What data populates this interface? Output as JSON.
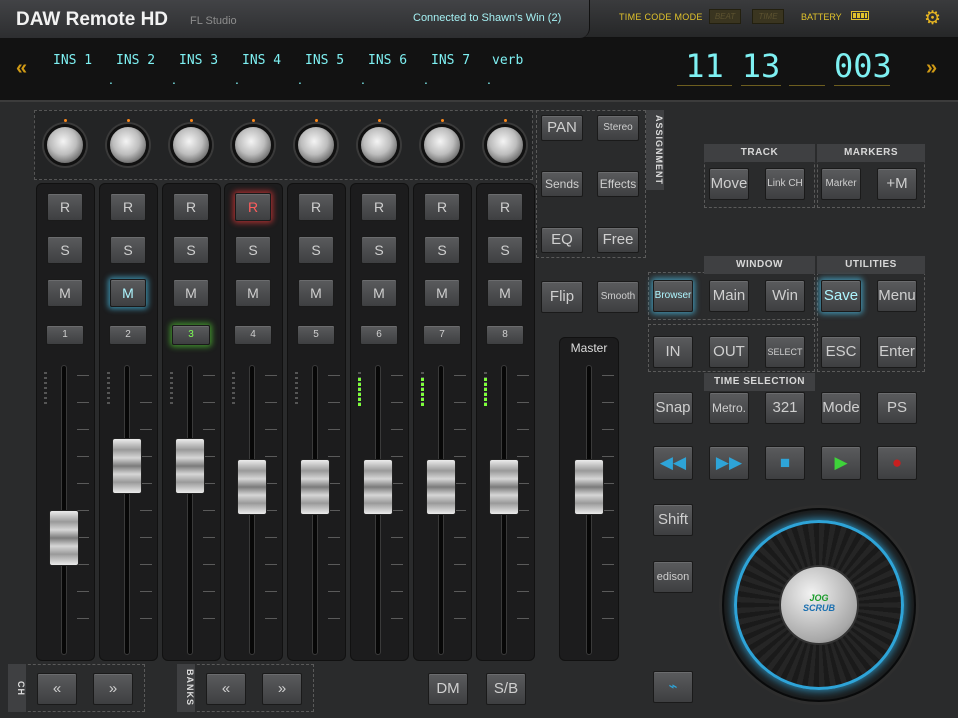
{
  "app": {
    "title": "DAW Remote HD",
    "subtitle": "FL Studio",
    "connection": "Connected to Shawn's Win (2)"
  },
  "status": {
    "time_code_mode_label": "TIME CODE MODE",
    "tc_opt1": "BEAT",
    "tc_opt2": "TIME",
    "battery_label": "BATTERY"
  },
  "icons": {
    "settings": "gear-icon",
    "prev": "double-chevron-left-icon",
    "next": "double-chevron-right-icon"
  },
  "display": {
    "inserts": [
      "INS 1",
      "INS 2",
      "INS 3",
      "INS 4",
      "INS 5",
      "INS 6",
      "INS 7",
      "verb"
    ],
    "dot": ".",
    "timecode": {
      "bars": "11",
      "beats": "13",
      "sub": "",
      "ticks": "003"
    }
  },
  "channels": [
    {
      "rec": "R",
      "solo": "S",
      "mute": "M",
      "num": "1",
      "rec_on": false,
      "mute_on": false,
      "sel_on": false,
      "level": 0.38
    },
    {
      "rec": "R",
      "solo": "S",
      "mute": "M",
      "num": "2",
      "rec_on": false,
      "mute_on": true,
      "sel_on": false,
      "level": 0.69
    },
    {
      "rec": "R",
      "solo": "S",
      "mute": "M",
      "num": "3",
      "rec_on": false,
      "mute_on": false,
      "sel_on": true,
      "level": 0.69
    },
    {
      "rec": "R",
      "solo": "S",
      "mute": "M",
      "num": "4",
      "rec_on": true,
      "mute_on": false,
      "sel_on": false,
      "level": 0.6
    },
    {
      "rec": "R",
      "solo": "S",
      "mute": "M",
      "num": "5",
      "rec_on": false,
      "mute_on": false,
      "sel_on": false,
      "level": 0.6
    },
    {
      "rec": "R",
      "solo": "S",
      "mute": "M",
      "num": "6",
      "rec_on": false,
      "mute_on": false,
      "sel_on": false,
      "level": 0.6
    },
    {
      "rec": "R",
      "solo": "S",
      "mute": "M",
      "num": "7",
      "rec_on": false,
      "mute_on": false,
      "sel_on": false,
      "level": 0.6
    },
    {
      "rec": "R",
      "solo": "S",
      "mute": "M",
      "num": "8",
      "rec_on": false,
      "mute_on": false,
      "sel_on": false,
      "level": 0.6
    }
  ],
  "master": {
    "label": "Master",
    "level": 0.6
  },
  "assignment": {
    "label": "ASSIGNMENT",
    "pan": "PAN",
    "stereo": "Stereo",
    "sends": "Sends",
    "effects": "Effects",
    "eq": "EQ",
    "free": "Free"
  },
  "flip": "Flip",
  "smooth": "Smooth",
  "track": {
    "label": "TRACK",
    "move": "Move",
    "link_ch": "Link CH"
  },
  "markers": {
    "label": "MARKERS",
    "marker": "Marker",
    "plus_m": "+M"
  },
  "window": {
    "label": "WINDOW",
    "browser": "Browser",
    "main": "Main",
    "win": "Win"
  },
  "utilities": {
    "label": "UTILITIES",
    "save": "Save",
    "menu": "Menu",
    "esc": "ESC",
    "enter": "Enter"
  },
  "io": {
    "in": "IN",
    "out": "OUT",
    "select": "SELECT"
  },
  "time_selection": {
    "label": "TIME SELECTION",
    "snap": "Snap",
    "metro": "Metro.",
    "count": "321",
    "mode": "Mode",
    "ps": "PS"
  },
  "transport": {
    "rewind": "◀◀",
    "ffwd": "▶▶",
    "stop": "■",
    "play": "▶",
    "record": "●"
  },
  "shift": "Shift",
  "edison": "edison",
  "jog": {
    "top": "JOG",
    "bottom": "SCRUB"
  },
  "ch": {
    "label": "CH",
    "prev": "«",
    "next": "»"
  },
  "banks": {
    "label": "BANKS",
    "prev": "«",
    "next": "»"
  },
  "dm": "DM",
  "sb": "S/B",
  "colors": {
    "accent_cyan": "#7ef0f2",
    "accent_yellow": "#e0c22b",
    "play_green": "#3ed33a",
    "record_red": "#c81f1f"
  }
}
